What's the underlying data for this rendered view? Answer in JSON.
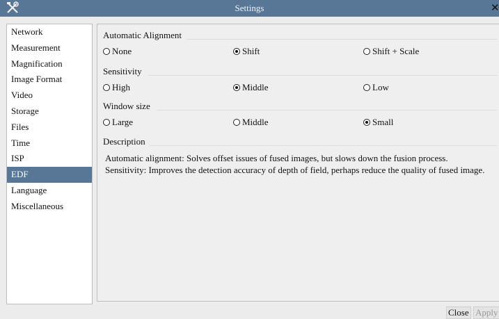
{
  "window": {
    "title": "Settings"
  },
  "sidebar": {
    "items": [
      {
        "label": "Network"
      },
      {
        "label": "Measurement"
      },
      {
        "label": "Magnification"
      },
      {
        "label": "Image Format"
      },
      {
        "label": "Video"
      },
      {
        "label": "Storage"
      },
      {
        "label": "Files"
      },
      {
        "label": "Time"
      },
      {
        "label": "ISP"
      },
      {
        "label": "EDF",
        "selected": true
      },
      {
        "label": "Language"
      },
      {
        "label": "Miscellaneous"
      }
    ]
  },
  "edf": {
    "alignment": {
      "title": "Automatic Alignment",
      "options": [
        "None",
        "Shift",
        "Shift + Scale"
      ],
      "selected": "Shift"
    },
    "sensitivity": {
      "title": "Sensitivity",
      "options": [
        "High",
        "Middle",
        "Low"
      ],
      "selected": "Middle"
    },
    "window_size": {
      "title": "Window size",
      "options": [
        "Large",
        "Middle",
        "Small"
      ],
      "selected": "Small"
    },
    "description": {
      "title": "Description",
      "lines": [
        "Automatic alignment: Solves offset issues of fused images, but slows down the fusion process.",
        "Sensitivity: Improves the detection accuracy of depth of field, perhaps reduce the quality of fused image."
      ]
    }
  },
  "buttons": {
    "close": "Close",
    "apply": "Apply",
    "apply_enabled": false
  },
  "colors": {
    "titlebar": "#587796",
    "selection": "#587796",
    "background": "#ececec"
  }
}
